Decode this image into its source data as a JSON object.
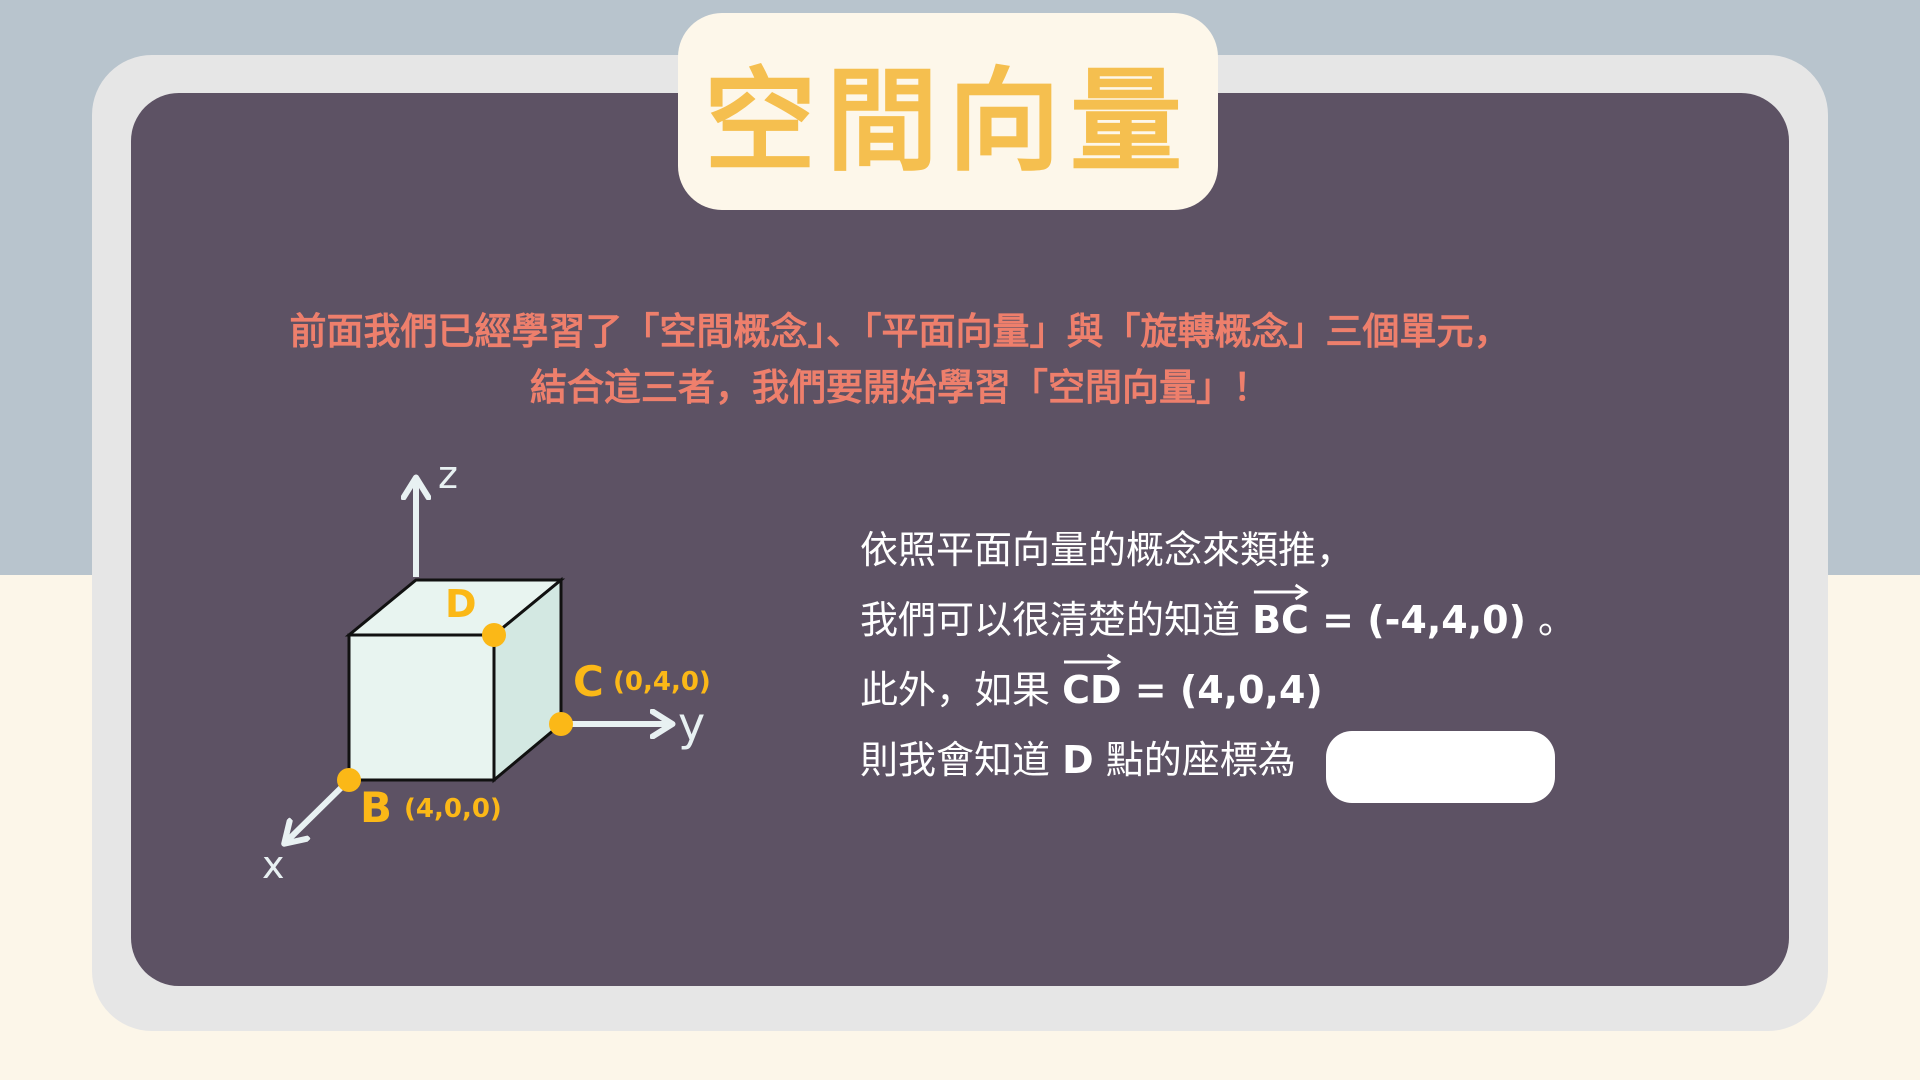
{
  "title": "空間向量",
  "intro": {
    "line1": "前面我們已經學習了「空間概念」、「平面向量」與「旋轉概念」三個單元，",
    "line2": "結合這三者，我們要開始學習「空間向量」！"
  },
  "diagram": {
    "axis_labels": {
      "x": "x",
      "y": "y",
      "z": "z"
    },
    "points": [
      {
        "label": "D",
        "coord": ""
      },
      {
        "label": "C",
        "coord": "(0,4,0)"
      },
      {
        "label": "B",
        "coord": "(4,0,0)"
      }
    ]
  },
  "explanation": {
    "line1": "依照平面向量的概念來類推，",
    "line2_prefix": "我們可以很清楚的知道 ",
    "vector_bc": "BC",
    "line2_value": " = (-4,4,0)",
    "line2_suffix": " 。",
    "line3_prefix": "此外，如果 ",
    "vector_cd": "CD",
    "line3_value": " = (4,0,4)",
    "line4_prefix": "則我會知道 ",
    "line4_d": "D",
    "line4_suffix": " 點的座標為",
    "answer": ""
  },
  "colors": {
    "title": "#f5bf4f",
    "intro": "#ee7f6c",
    "board": "#5d5264",
    "point": "#fbb817",
    "cube_front": "#e8f4f0",
    "cube_side": "#d3e8e2"
  }
}
